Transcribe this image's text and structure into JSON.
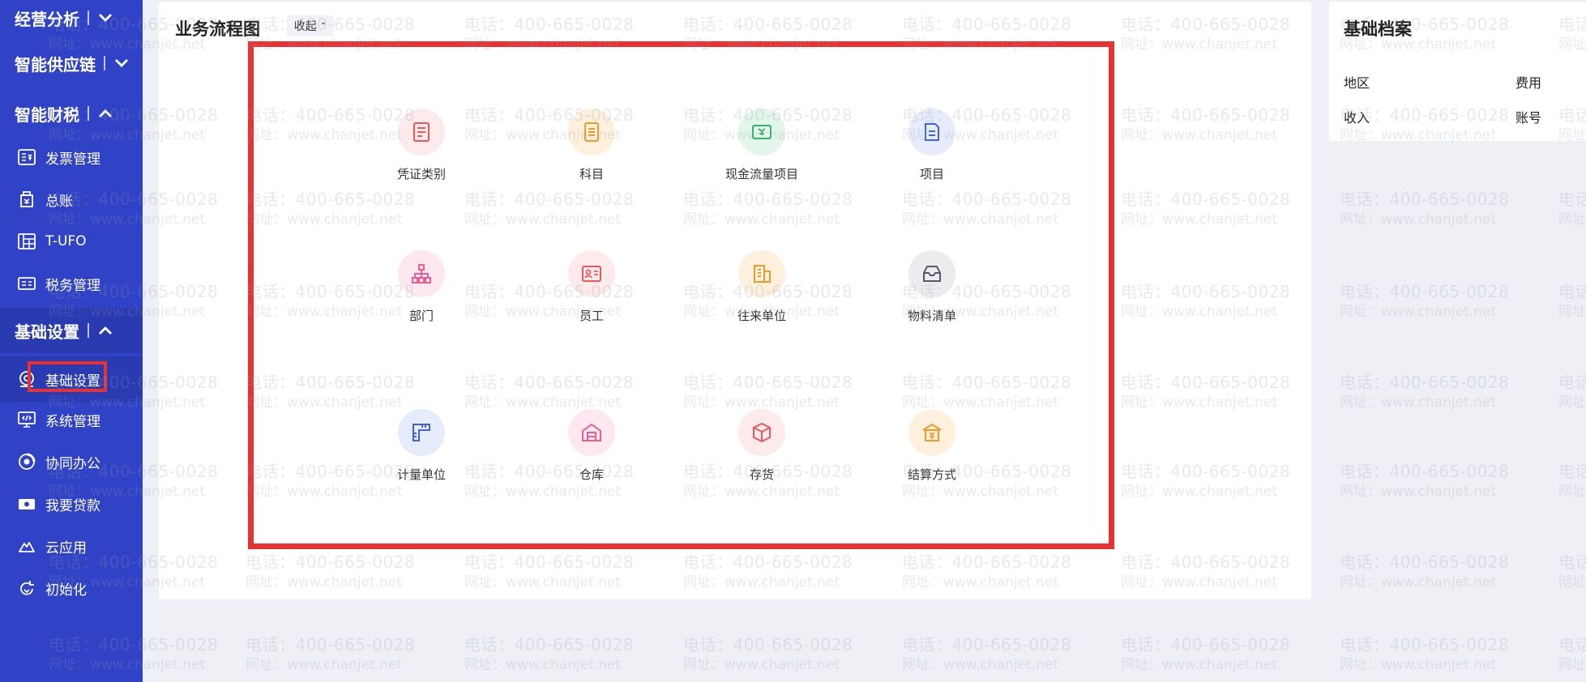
{
  "sidebar": {
    "groups": [
      {
        "label": "经营分析",
        "chevron": "chevron-down-icon"
      },
      {
        "label": "智能供应链",
        "chevron": "chevron-down-icon"
      },
      {
        "label": "智能财税",
        "chevron": "chevron-up-icon"
      },
      {
        "label": "基础设置",
        "chevron": "chevron-up-icon"
      }
    ],
    "items": [
      {
        "label": "发票管理",
        "icon": "invoice-icon"
      },
      {
        "label": "总账",
        "icon": "ledger-icon"
      },
      {
        "label": "T-UFO",
        "icon": "report-icon"
      },
      {
        "label": "税务管理",
        "icon": "tax-icon"
      },
      {
        "label": "基础设置",
        "icon": "settings-icon",
        "active": true
      },
      {
        "label": "系统管理",
        "icon": "system-icon"
      },
      {
        "label": "协同办公",
        "icon": "collaboration-icon"
      },
      {
        "label": "我要贷款",
        "icon": "loan-icon"
      },
      {
        "label": "云应用",
        "icon": "cloud-icon"
      },
      {
        "label": "初始化",
        "icon": "refresh-icon"
      }
    ]
  },
  "flow": {
    "title": "业务流程图",
    "collapse_label": "收起",
    "items": [
      {
        "label": "凭证类别",
        "icon": "voucher-icon",
        "color": "#e9585a",
        "bg": "#fdeaea"
      },
      {
        "label": "科目",
        "icon": "subject-icon",
        "color": "#f09a28",
        "bg": "#fdf0dd"
      },
      {
        "label": "现金流量项目",
        "icon": "cashflow-icon",
        "color": "#34b36a",
        "bg": "#e3f6ea"
      },
      {
        "label": "项目",
        "icon": "project-icon",
        "color": "#3e63dd",
        "bg": "#e6ecfb"
      },
      {
        "label": "部门",
        "icon": "department-icon",
        "color": "#ec5e93",
        "bg": "#fde8f0"
      },
      {
        "label": "员工",
        "icon": "employee-icon",
        "color": "#e9585a",
        "bg": "#fdeaea"
      },
      {
        "label": "往来单位",
        "icon": "partner-icon",
        "color": "#f09a28",
        "bg": "#fdf0dd"
      },
      {
        "label": "物料清单",
        "icon": "bom-icon",
        "color": "#555a66",
        "bg": "#ececef"
      },
      {
        "label": "计量单位",
        "icon": "ruler-icon",
        "color": "#3e63dd",
        "bg": "#e6ecfb"
      },
      {
        "label": "仓库",
        "icon": "warehouse-icon",
        "color": "#ec5e93",
        "bg": "#fde8f0"
      },
      {
        "label": "存货",
        "icon": "inventory-icon",
        "color": "#e9585a",
        "bg": "#fdeaea"
      },
      {
        "label": "结算方式",
        "icon": "settlement-icon",
        "color": "#f09a28",
        "bg": "#fdf0dd"
      }
    ]
  },
  "archive": {
    "title": "基础档案",
    "fields": [
      "地区",
      "费用",
      "收入",
      "账号"
    ]
  },
  "watermark": {
    "phone": "电话：400-665-0028",
    "site": "网址：www.chanjet.net"
  }
}
